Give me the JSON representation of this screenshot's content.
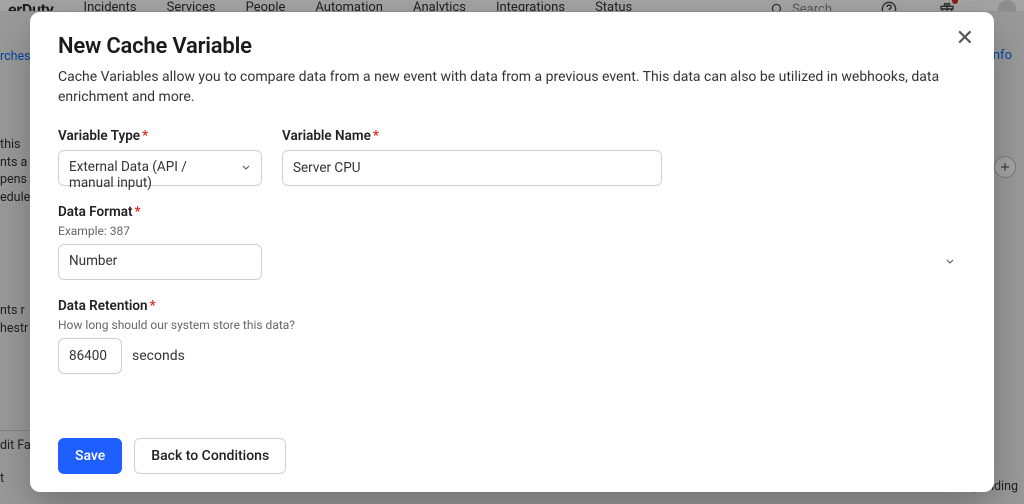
{
  "app": {
    "brand_partial": "erDuty",
    "nav": [
      "Incidents",
      "Services",
      "People",
      "Automation",
      "Analytics",
      "Integrations",
      "Status"
    ],
    "search_placeholder": "Search",
    "info_label": "Info"
  },
  "bg_left_fragments": {
    "crumb": "rchest",
    "l1": "this",
    "l2": "nts a",
    "l3": "pens",
    "l4": "edule",
    "l5": "nts r",
    "l6": "hestr",
    "l7": "dit Fa",
    "l8": "t"
  },
  "bg_bottom_right": "und pending",
  "modal": {
    "title": "New Cache Variable",
    "description": "Cache Variables allow you to compare data from a new event with data from a previous event. This data can also be utilized in webhooks, data enrichment and more.",
    "variable_type": {
      "label": "Variable Type",
      "value": "External Data (API / manual input)"
    },
    "variable_name": {
      "label": "Variable Name",
      "value": "Server CPU"
    },
    "data_format": {
      "label": "Data Format",
      "hint": "Example: 387",
      "value": "Number"
    },
    "data_retention": {
      "label": "Data Retention",
      "hint": "How long should our system store this data?",
      "value": "86400",
      "unit": "seconds"
    },
    "buttons": {
      "save": "Save",
      "back": "Back to Conditions"
    }
  }
}
